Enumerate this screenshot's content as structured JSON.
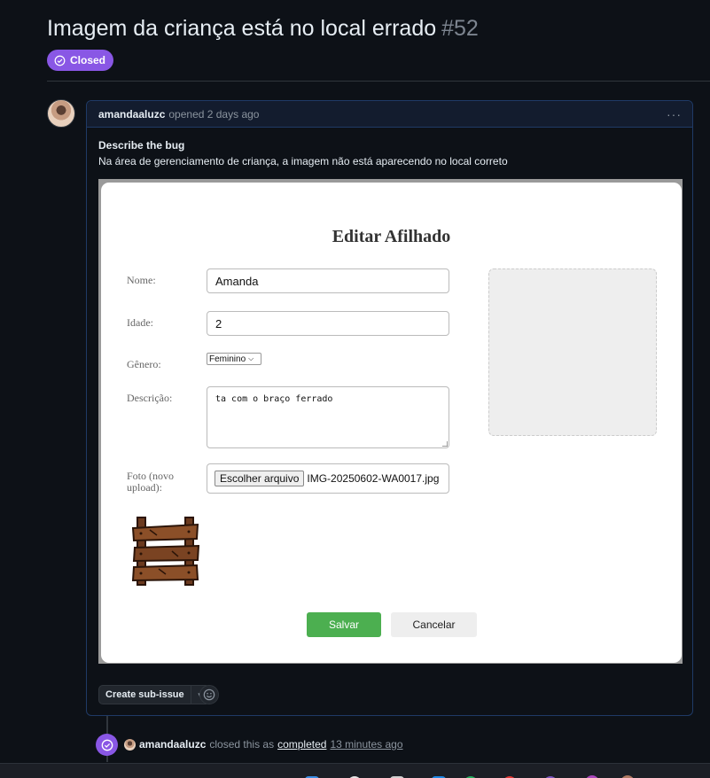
{
  "issue": {
    "title": "Imagem da criança está no local errado",
    "number": "#52",
    "state": "Closed"
  },
  "comment": {
    "author": "amandaaluzc",
    "meta": "opened 2 days ago",
    "menu_label": "···",
    "heading": "Describe the bug",
    "text": "Na área de gerenciamento de criança, a imagem não está aparecendo no local correto"
  },
  "screenshot": {
    "form_title": "Editar Afilhado",
    "fields": {
      "nome_label": "Nome:",
      "nome_value": "Amanda",
      "idade_label": "Idade:",
      "idade_value": "2",
      "genero_label": "Gênero:",
      "genero_value": "Feminino",
      "descricao_label": "Descrição:",
      "descricao_value": "ta com o braço ferrado",
      "foto_label_line1": "Foto (novo",
      "foto_label_line2": "upload):",
      "file_button": "Escolher arquivo",
      "file_name": "IMG-20250602-WA0017.jpg"
    },
    "buttons": {
      "save": "Salvar",
      "cancel": "Cancelar"
    }
  },
  "actions": {
    "create_sub_issue": "Create sub-issue"
  },
  "event": {
    "author": "amandaaluzc",
    "text": "closed this as",
    "link": "completed",
    "time": "13 minutes ago"
  },
  "colors": {
    "closed_purple": "#8957e5",
    "save_green": "#4caf50",
    "page_bg": "#0d1117"
  }
}
